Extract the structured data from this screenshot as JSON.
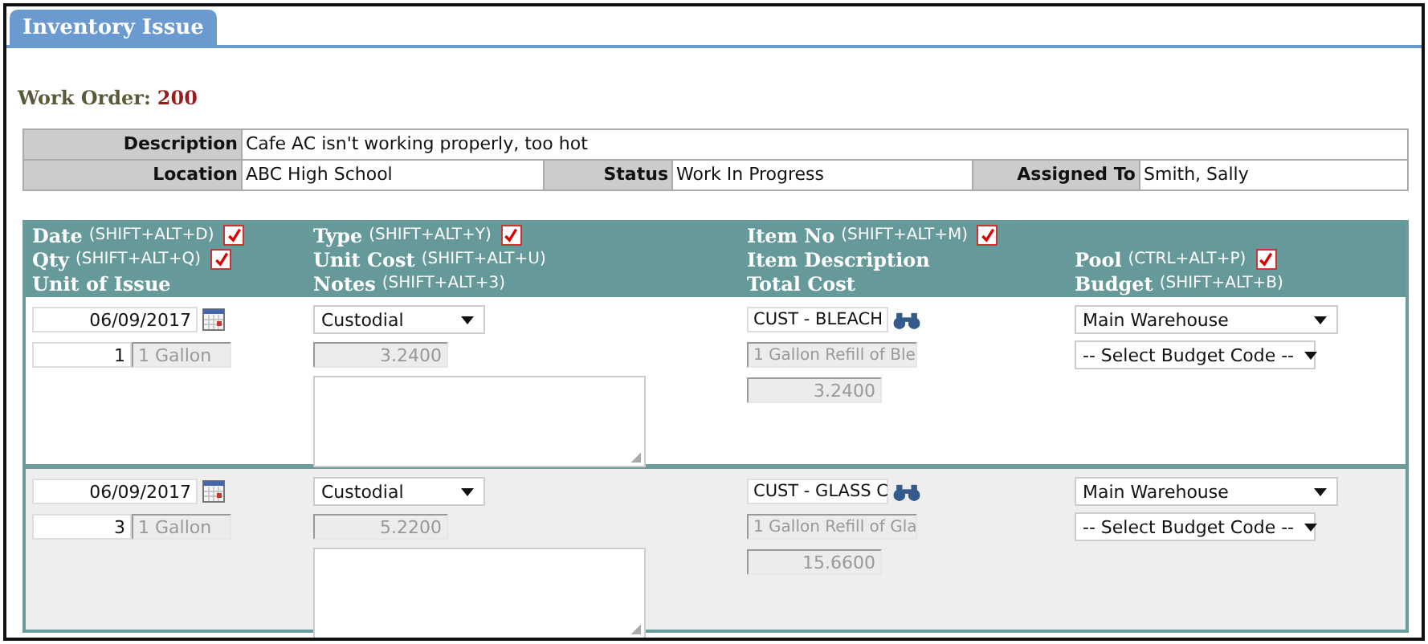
{
  "tab": {
    "label": "Inventory Issue"
  },
  "work_order": {
    "label": "Work Order:",
    "number": "200"
  },
  "info": {
    "description": {
      "label": "Description",
      "value": "Cafe AC isn't working properly, too hot"
    },
    "location": {
      "label": "Location",
      "value": "ABC High School"
    },
    "status": {
      "label": "Status",
      "value": "Work In Progress"
    },
    "assigned_to": {
      "label": "Assigned To",
      "value": "Smith, Sally"
    }
  },
  "columns": [
    {
      "lines": [
        {
          "label": "Date",
          "shortcut": "(SHIFT+ALT+D)",
          "checked": true
        },
        {
          "label": "Qty",
          "shortcut": "(SHIFT+ALT+Q)",
          "checked": true
        },
        {
          "label": "Unit of Issue"
        }
      ]
    },
    {
      "lines": [
        {
          "label": "Type",
          "shortcut": "(SHIFT+ALT+Y)",
          "checked": true
        },
        {
          "label": "Unit Cost",
          "shortcut": "(SHIFT+ALT+U)"
        },
        {
          "label": "Notes",
          "shortcut": "(SHIFT+ALT+3)"
        }
      ]
    },
    {
      "lines": [
        {
          "label": "Item No",
          "shortcut": "(SHIFT+ALT+M)",
          "checked": true
        },
        {
          "label": "Item Description"
        },
        {
          "label": "Total Cost"
        }
      ]
    },
    {
      "lines": [
        {
          "label": "Pool",
          "shortcut": "(CTRL+ALT+P)",
          "checked": true
        },
        {
          "label": "Budget",
          "shortcut": "(SHIFT+ALT+B)"
        }
      ]
    }
  ],
  "rows": [
    {
      "date": "06/09/2017",
      "qty": "1",
      "unit": "1 Gallon",
      "type": "Custodial",
      "unit_cost": "3.2400",
      "item_no": "CUST - BLEACH",
      "item_description": "1 Gallon Refill of Ble",
      "total_cost": "3.2400",
      "pool": "Main Warehouse",
      "budget": "-- Select Budget Code --"
    },
    {
      "date": "06/09/2017",
      "qty": "3",
      "unit": "1 Gallon",
      "type": "Custodial",
      "unit_cost": "5.2200",
      "item_no": "CUST - GLASS C",
      "item_description": "1 Gallon Refill of Gla",
      "total_cost": "15.6600",
      "pool": "Main Warehouse",
      "budget": "-- Select Budget Code --"
    }
  ]
}
